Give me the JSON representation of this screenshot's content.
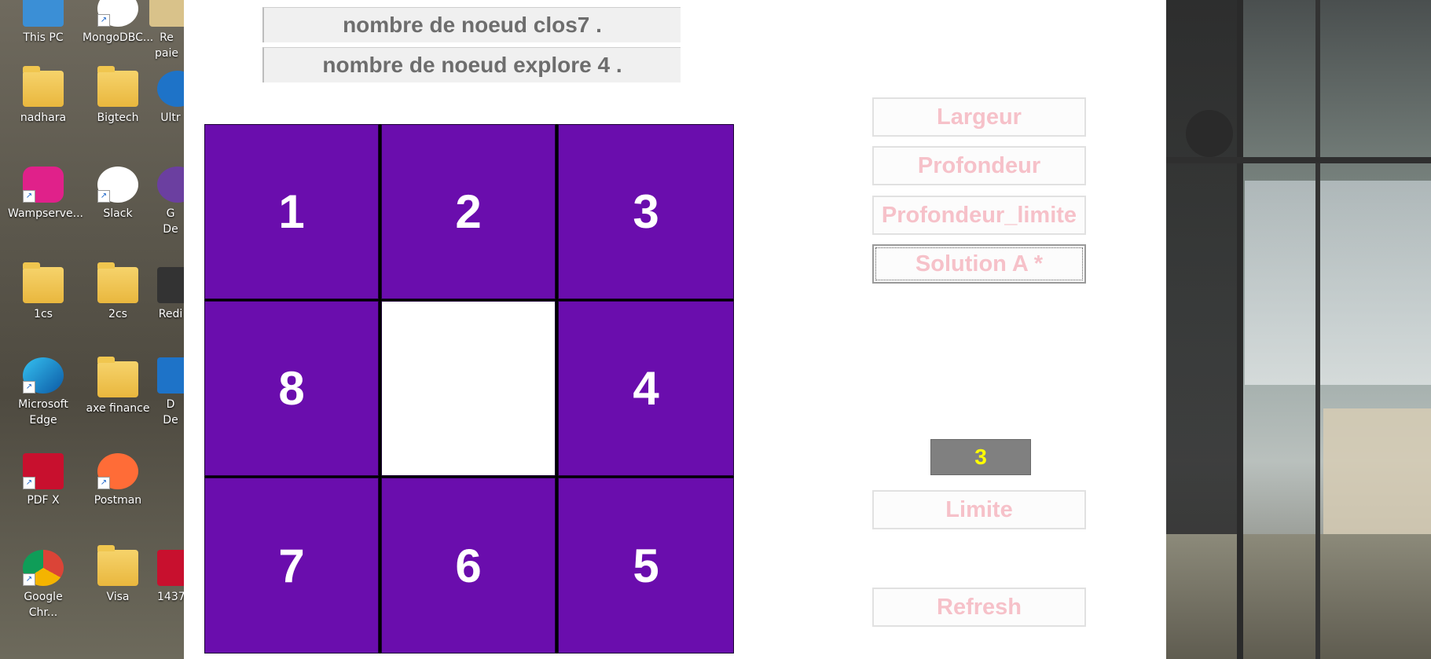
{
  "desktop": {
    "icons": [
      {
        "label": "This PC"
      },
      {
        "label": "MongoDBC..."
      },
      {
        "label": "Re paie"
      },
      {
        "label": "nadhara"
      },
      {
        "label": "Bigtech"
      },
      {
        "label": "Ultr"
      },
      {
        "label": "Wampserve..."
      },
      {
        "label": "Slack"
      },
      {
        "label": "G De"
      },
      {
        "label": "1cs"
      },
      {
        "label": "2cs"
      },
      {
        "label": "Redi"
      },
      {
        "label": "Microsoft Edge"
      },
      {
        "label": "axe finance"
      },
      {
        "label": "D De"
      },
      {
        "label": "PDF X"
      },
      {
        "label": "Postman"
      },
      {
        "label": "Google Chr..."
      },
      {
        "label": "Visa"
      },
      {
        "label": "1437"
      }
    ]
  },
  "app": {
    "closed_nodes": "nombre de noeud clos7 .",
    "explored_nodes": "nombre de noeud explore 4 .",
    "board": {
      "tiles": [
        "1",
        "2",
        "3",
        "8",
        "",
        "4",
        "7",
        "6",
        "5"
      ]
    },
    "buttons": {
      "largeur": "Largeur",
      "profondeur": "Profondeur",
      "profondeur_limite": "Profondeur_limite",
      "solution_a": "Solution A *",
      "limite": "Limite",
      "refresh": "Refresh"
    },
    "limit_value": "3",
    "colors": {
      "tile": "#6a0dad",
      "empty_tile": "#ffffff",
      "button_text": "#f6c1c9",
      "counter_bg": "#808080",
      "counter_text": "#ffff00"
    }
  }
}
